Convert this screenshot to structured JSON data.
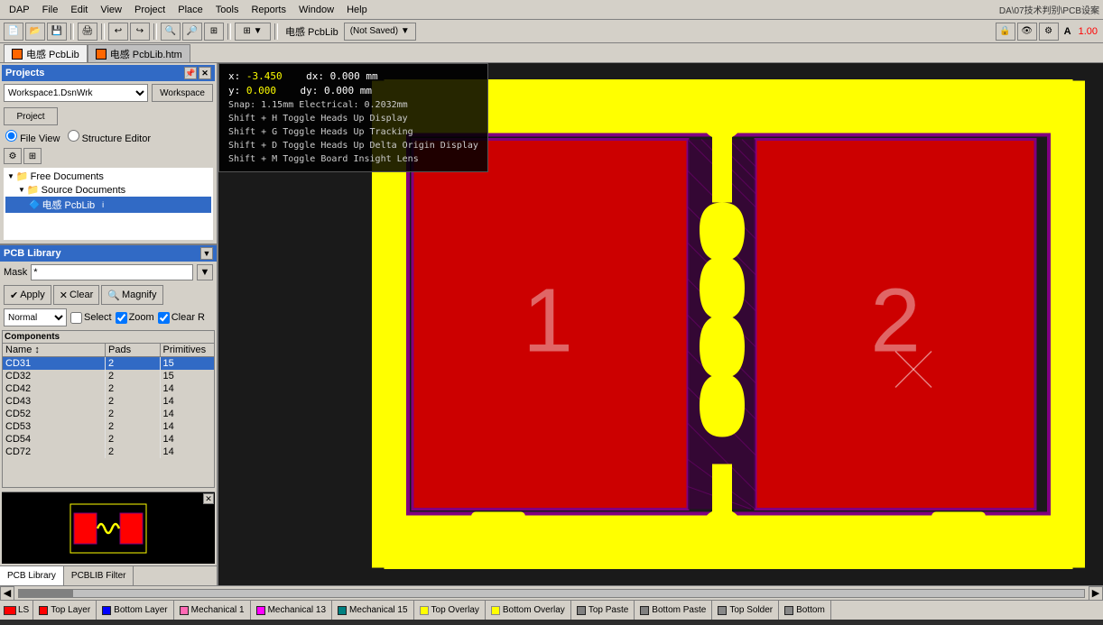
{
  "menubar": {
    "items": [
      "DAP",
      "File",
      "Edit",
      "View",
      "Project",
      "Place",
      "Tools",
      "Reports",
      "Window",
      "Help"
    ]
  },
  "titlebar": {
    "text": "DA\\07技术判别\\PCB设案"
  },
  "tabs": [
    {
      "label": "电感 PcbLib",
      "active": true
    },
    {
      "label": "电感 PcbLib.htm",
      "active": false
    }
  ],
  "coords": {
    "x_label": "x:",
    "x_val": "-3.450",
    "dx_label": "dx:",
    "dx_val": "0.000 mm",
    "y_label": "y:",
    "y_val": "0.000",
    "dy_label": "dy:",
    "dy_val": "0.000 mm",
    "snap": "Snap: 1.15mm Electrical: 0.2032mm",
    "hint1": "Shift + H   Toggle Heads Up Display",
    "hint2": "Shift + G   Toggle Heads Up Tracking",
    "hint3": "Shift + D   Toggle Heads Up Delta Origin Display",
    "hint4": "Shift + M   Toggle Board Insight Lens"
  },
  "projects": {
    "title": "Projects",
    "workspace_label": "Workspace1.DsnWrk",
    "workspace_btn": "Workspace",
    "project_btn": "Project",
    "view_modes": [
      "File View",
      "Structure Editor"
    ],
    "tree": [
      {
        "label": "Free Documents",
        "type": "folder",
        "indent": 0
      },
      {
        "label": "Source Documents",
        "type": "folder",
        "indent": 1
      },
      {
        "label": "电感 PcbLib",
        "type": "file",
        "indent": 2,
        "selected": true
      }
    ]
  },
  "pcblib": {
    "title": "PCB Library",
    "mask_label": "Mask",
    "mask_value": "*",
    "apply_btn": "Apply",
    "clear_btn": "Clear",
    "magnify_btn": "Magnify",
    "mode_value": "Normal",
    "select_label": "Select",
    "zoom_label": "Zoom",
    "clear_label": "Clear R",
    "columns": [
      "Name",
      "Pads",
      "Primitives"
    ],
    "components": [
      {
        "name": "CD31",
        "pads": "2",
        "primitives": "15",
        "selected": true
      },
      {
        "name": "CD32",
        "pads": "2",
        "primitives": "15"
      },
      {
        "name": "CD42",
        "pads": "2",
        "primitives": "14"
      },
      {
        "name": "CD43",
        "pads": "2",
        "primitives": "14"
      },
      {
        "name": "CD52",
        "pads": "2",
        "primitives": "14"
      },
      {
        "name": "CD53",
        "pads": "2",
        "primitives": "14"
      },
      {
        "name": "CD54",
        "pads": "2",
        "primitives": "14"
      },
      {
        "name": "CD72",
        "pads": "2",
        "primitives": "14"
      }
    ]
  },
  "left_tabs": [
    {
      "label": "PCB Library",
      "active": true
    },
    {
      "label": "PCBLIB Filter",
      "active": false
    }
  ],
  "canvas": {
    "bg_color": "#1a1a1a",
    "pad1_label": "1",
    "pad2_label": "2"
  },
  "statusbar": {
    "ls_label": "LS",
    "indicator_color": "#ff0000"
  },
  "layer_tabs": [
    {
      "label": "Top Layer",
      "color": "#ff0000"
    },
    {
      "label": "Bottom Layer",
      "color": "#0000ff"
    },
    {
      "label": "Mechanical 1",
      "color": "#ff69b4"
    },
    {
      "label": "Mechanical 13",
      "color": "#ff00ff"
    },
    {
      "label": "Mechanical 15",
      "color": "#008080"
    },
    {
      "label": "Top Overlay",
      "color": "#ffff00"
    },
    {
      "label": "Bottom Overlay",
      "color": "#ffff00"
    },
    {
      "label": "Top Paste",
      "color": "#808080"
    },
    {
      "label": "Bottom Paste",
      "color": "#808080"
    },
    {
      "label": "Top Solder",
      "color": "#808080"
    },
    {
      "label": "Bottom",
      "color": "#808080"
    }
  ]
}
